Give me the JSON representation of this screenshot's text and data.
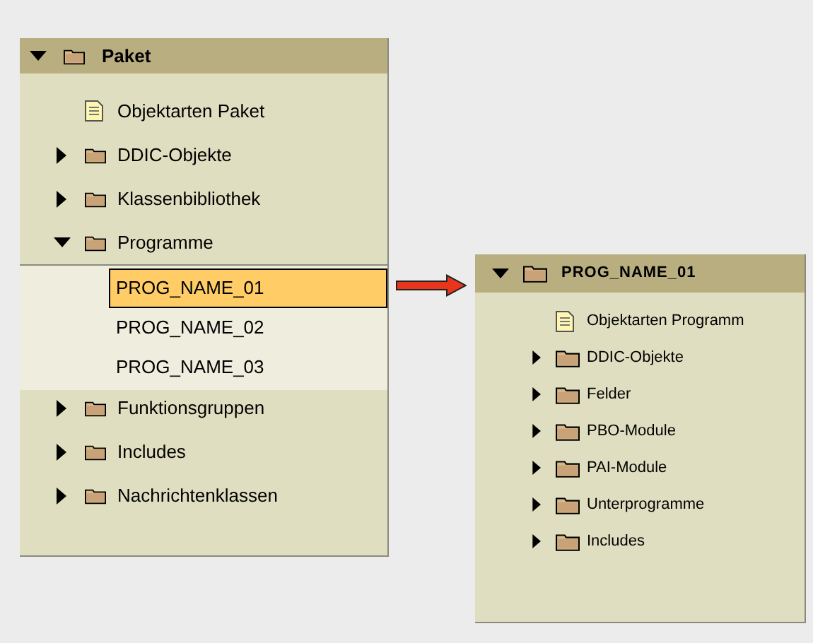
{
  "left_panel": {
    "title": "Paket",
    "expanded": true,
    "items": [
      {
        "kind": "document",
        "label": "Objektarten Paket"
      },
      {
        "kind": "folder",
        "label": "DDIC-Objekte",
        "expanded": false
      },
      {
        "kind": "folder",
        "label": "Klassenbibliothek",
        "expanded": false
      },
      {
        "kind": "folder",
        "label": "Programme",
        "expanded": true,
        "children": [
          {
            "label": "PROG_NAME_01",
            "selected": true
          },
          {
            "label": "PROG_NAME_02",
            "selected": false
          },
          {
            "label": "PROG_NAME_03",
            "selected": false
          }
        ]
      },
      {
        "kind": "folder",
        "label": "Funktionsgruppen",
        "expanded": false
      },
      {
        "kind": "folder",
        "label": "Includes",
        "expanded": false
      },
      {
        "kind": "folder",
        "label": "Nachrichtenklassen",
        "expanded": false
      }
    ]
  },
  "right_panel": {
    "title": "PROG_NAME_01",
    "expanded": true,
    "items": [
      {
        "kind": "document",
        "label": "Objektarten Programm"
      },
      {
        "kind": "folder",
        "label": "DDIC-Objekte",
        "expanded": false
      },
      {
        "kind": "folder",
        "label": "Felder",
        "expanded": false
      },
      {
        "kind": "folder",
        "label": "PBO-Module",
        "expanded": false
      },
      {
        "kind": "folder",
        "label": "PAI-Module",
        "expanded": false
      },
      {
        "kind": "folder",
        "label": "Unterprogramme",
        "expanded": false
      },
      {
        "kind": "folder",
        "label": "Includes",
        "expanded": false
      }
    ]
  }
}
